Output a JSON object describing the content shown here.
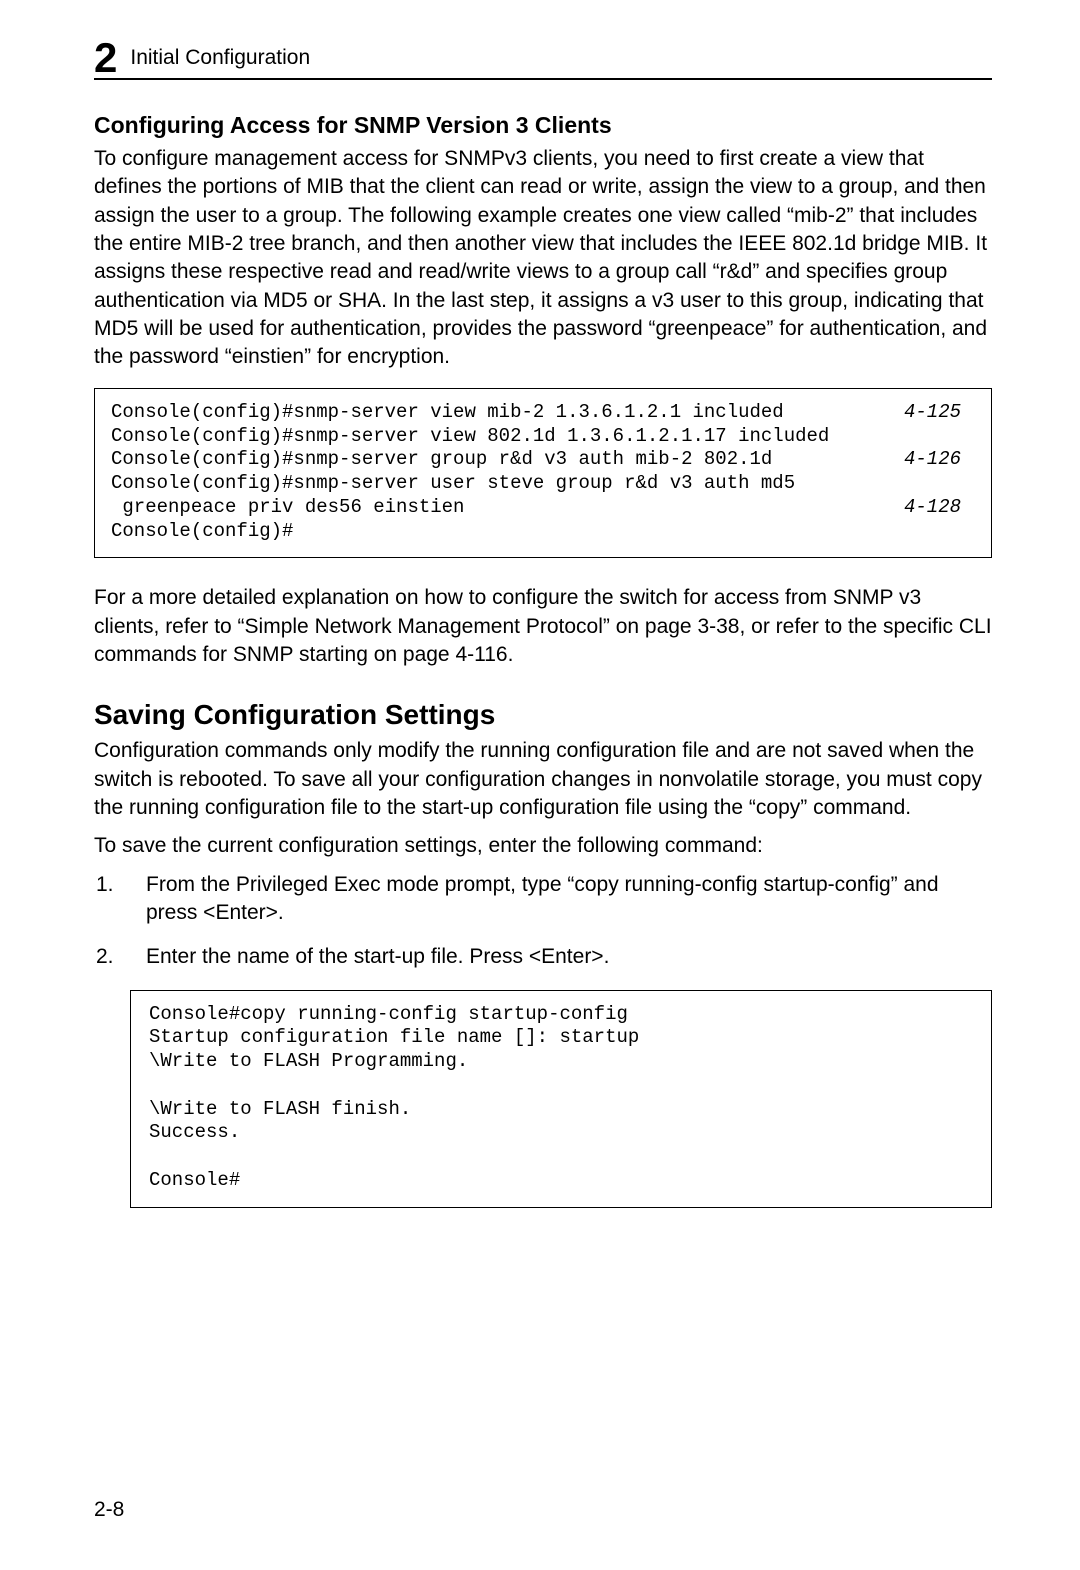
{
  "header": {
    "chapter_number": "2",
    "title": "Initial Configuration"
  },
  "section1": {
    "heading": "Configuring Access for SNMP Version 3 Clients",
    "intro": "To configure management access for SNMPv3 clients, you need to first create a view that defines the portions of MIB that the client can read or write, assign the view to a group, and then assign the user to a group. The following example creates one view called “mib-2” that includes the entire MIB-2 tree branch, and then another view that includes the IEEE 802.1d bridge MIB. It assigns these respective read and read/write views to a group call “r&d” and specifies group authentication via MD5 or SHA. In the last step, it assigns a v3 user to this group, indicating that MD5 will be used for authentication, provides the password “greenpeace” for authentication, and the password “einstien” for encryption."
  },
  "code1": {
    "lines": [
      "Console(config)#snmp-server view mib-2 1.3.6.1.2.1 included",
      "Console(config)#snmp-server view 802.1d 1.3.6.1.2.1.17 included",
      "Console(config)#snmp-server group r&d v3 auth mib-2 802.1d",
      "Console(config)#snmp-server user steve group r&d v3 auth md5",
      " greenpeace priv des56 einstien",
      "Console(config)#"
    ],
    "refs": {
      "0": "4-125",
      "2": "4-126",
      "4": "4-128"
    }
  },
  "paragraph2": "For a more detailed explanation on how to configure the switch for access from SNMP v3 clients, refer to “Simple Network Management Protocol” on page 3-38, or refer to the specific CLI commands for SNMP starting on page 4-116.",
  "section2": {
    "heading": "Saving Configuration Settings",
    "p1": "Configuration commands only modify the running configuration file and are not saved when the switch is rebooted. To save all your configuration changes in nonvolatile storage, you must copy the running configuration file to the start-up configuration file using the “copy” command.",
    "p2": "To save the current configuration settings, enter the following command:",
    "steps": [
      "From the Privileged Exec mode prompt, type “copy running-config startup-config” and press <Enter>.",
      "Enter the name of the start-up file. Press <Enter>."
    ]
  },
  "code2": "Console#copy running-config startup-config\nStartup configuration file name []: startup\n\\Write to FLASH Programming.\n\n\\Write to FLASH finish.\nSuccess.\n\nConsole#",
  "page_number": "2-8"
}
